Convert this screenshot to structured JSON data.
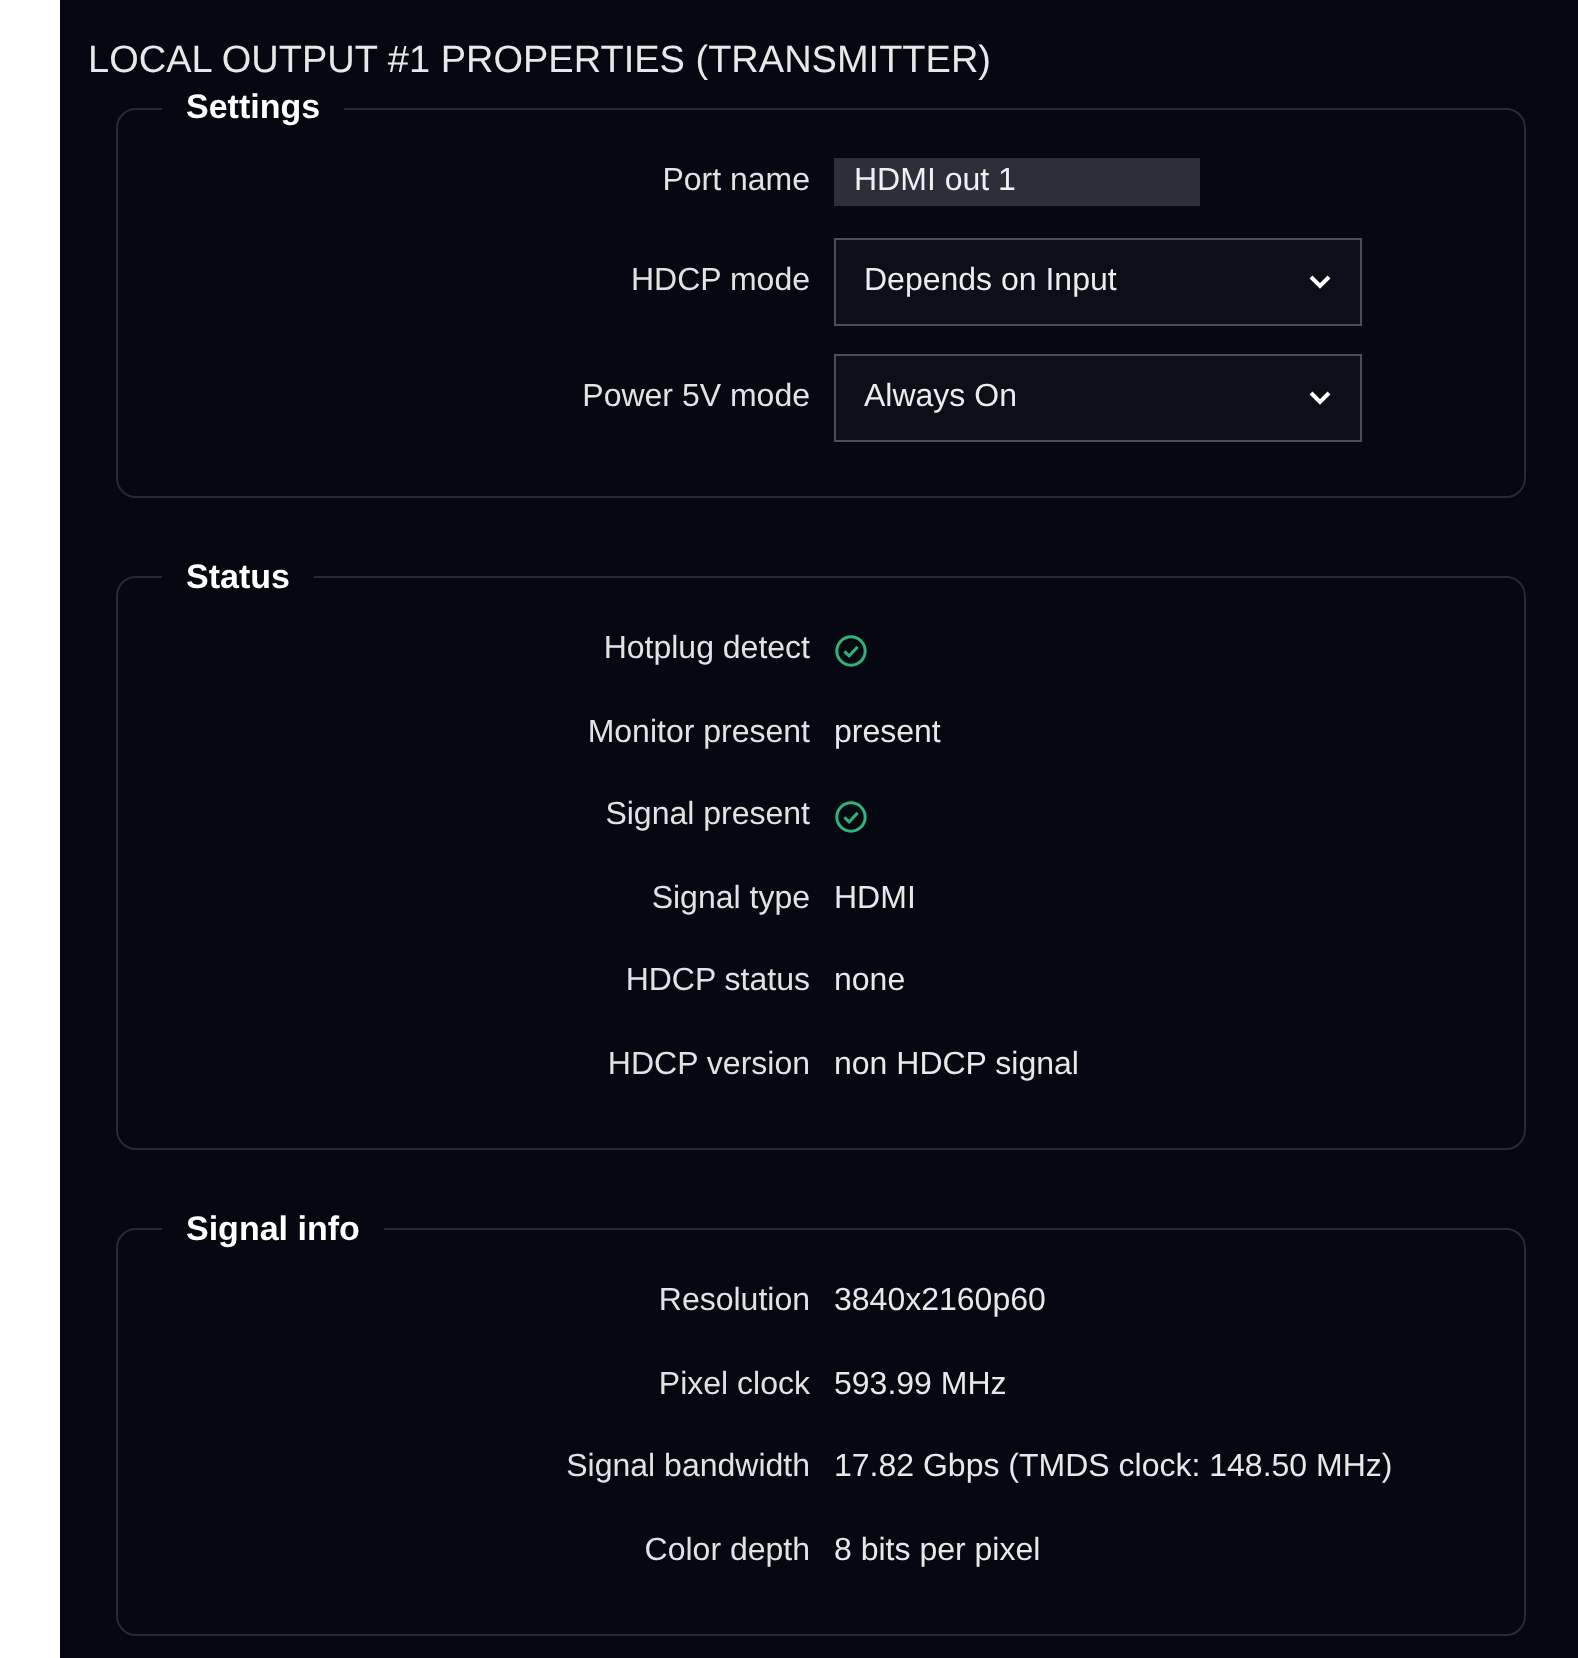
{
  "title": "LOCAL OUTPUT #1 PROPERTIES (TRANSMITTER)",
  "sections": [
    {
      "legend": "Settings",
      "rows": [
        {
          "kind": "field",
          "label": "Port name",
          "value": "HDMI out 1"
        },
        {
          "kind": "select",
          "label": "HDCP mode",
          "value": "Depends on Input"
        },
        {
          "kind": "select",
          "label": "Power 5V mode",
          "value": "Always On"
        }
      ]
    },
    {
      "legend": "Status",
      "rows": [
        {
          "kind": "indicator",
          "label": "Hotplug detect",
          "on": true
        },
        {
          "kind": "text",
          "label": "Monitor present",
          "value": "present"
        },
        {
          "kind": "indicator",
          "label": "Signal present",
          "on": true
        },
        {
          "kind": "text",
          "label": "Signal type",
          "value": "HDMI"
        },
        {
          "kind": "text",
          "label": "HDCP status",
          "value": "none"
        },
        {
          "kind": "text",
          "label": "HDCP version",
          "value": "non HDCP signal"
        }
      ]
    },
    {
      "legend": "Signal info",
      "rows": [
        {
          "kind": "text",
          "label": "Resolution",
          "value": "3840x2160p60"
        },
        {
          "kind": "text",
          "label": "Pixel clock",
          "value": "593.99 MHz"
        },
        {
          "kind": "text",
          "label": "Signal bandwidth",
          "value": "17.82 Gbps (TMDS clock: 148.50 MHz)"
        },
        {
          "kind": "text",
          "label": "Color depth",
          "value": "8 bits per pixel"
        }
      ]
    }
  ]
}
